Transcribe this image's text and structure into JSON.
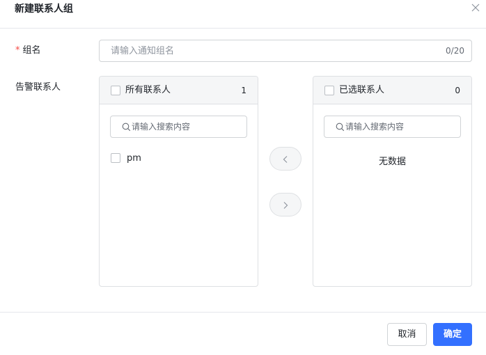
{
  "dialog": {
    "title": "新建联系人组",
    "close_icon": "close-icon"
  },
  "form": {
    "group_name": {
      "required_mark": "*",
      "label": "组名",
      "value": "",
      "placeholder": "请输入通知组名",
      "counter": "0/20"
    },
    "contacts_label": "告警联系人"
  },
  "transfer": {
    "left": {
      "header_label": "所有联系人",
      "count": "1",
      "search_placeholder": "请输入搜索内容",
      "items": [
        {
          "label": "pm",
          "checked": false
        }
      ]
    },
    "right": {
      "header_label": "已选联系人",
      "count": "0",
      "search_placeholder": "请输入搜索内容",
      "empty_text": "无数据"
    },
    "move_left_icon": "chevron-left-icon",
    "move_right_icon": "chevron-right-icon"
  },
  "footer": {
    "cancel_label": "取消",
    "ok_label": "确定"
  },
  "colors": {
    "primary": "#3370ff",
    "required": "#f54a45",
    "border": "#dee0e3",
    "header_bg": "#f5f6f7"
  }
}
